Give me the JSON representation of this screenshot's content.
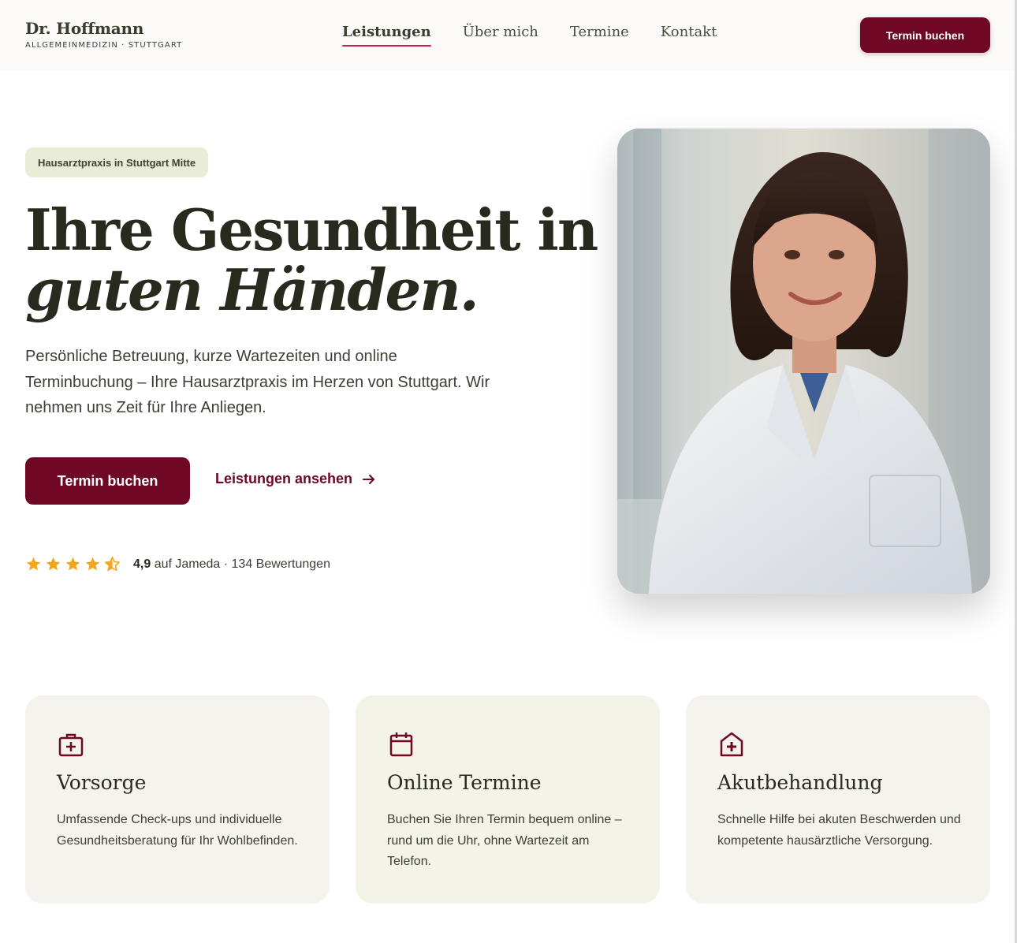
{
  "header": {
    "brand_name": "Dr. Hoffmann",
    "brand_sub": "ALLGEMEINMEDIZIN · STUTTGART",
    "nav": [
      {
        "label": "Leistungen",
        "active": true
      },
      {
        "label": "Über mich"
      },
      {
        "label": "Termine"
      },
      {
        "label": "Kontakt"
      }
    ],
    "cta_label": "Termin buchen"
  },
  "hero": {
    "badge": "Hausarztpraxis in Stuttgart Mitte",
    "title_line1": "Ihre Gesundheit in",
    "title_line2": "guten Händen.",
    "text": "Persönliche Betreuung, kurze Wartezeiten und online Terminbuchung – Ihre Hausarztpraxis im Herzen von Stuttgart. Wir nehmen uns Zeit für Ihre Anliegen.",
    "primary_button": "Termin buchen",
    "secondary_link": "Leistungen ansehen",
    "rating": {
      "score": "4,9",
      "text": "auf Jameda · 134 Bewertungen",
      "stars_value": 4.5,
      "star_color": "#f2a71b"
    }
  },
  "cards": [
    {
      "icon": "medical-kit-icon",
      "title": "Vorsorge",
      "text": "Umfassende Check-ups und individuelle Gesundheitsberatung für Ihr Wohlbefinden."
    },
    {
      "icon": "calendar-icon",
      "title": "Online Termine",
      "text": "Buchen Sie Ihren Termin bequem online – rund um die Uhr, ohne Wartezeit am Telefon."
    },
    {
      "icon": "clinic-icon",
      "title": "Akutbehandlung",
      "text": "Schnelle Hilfe bei akuten Beschwerden und kompetente hausärztliche Versorgung."
    }
  ],
  "colors": {
    "accent": "#6e0825",
    "nav_underline": "#c0244a",
    "badge_bg": "#e9ecd6",
    "text_dark": "#272a1d"
  }
}
